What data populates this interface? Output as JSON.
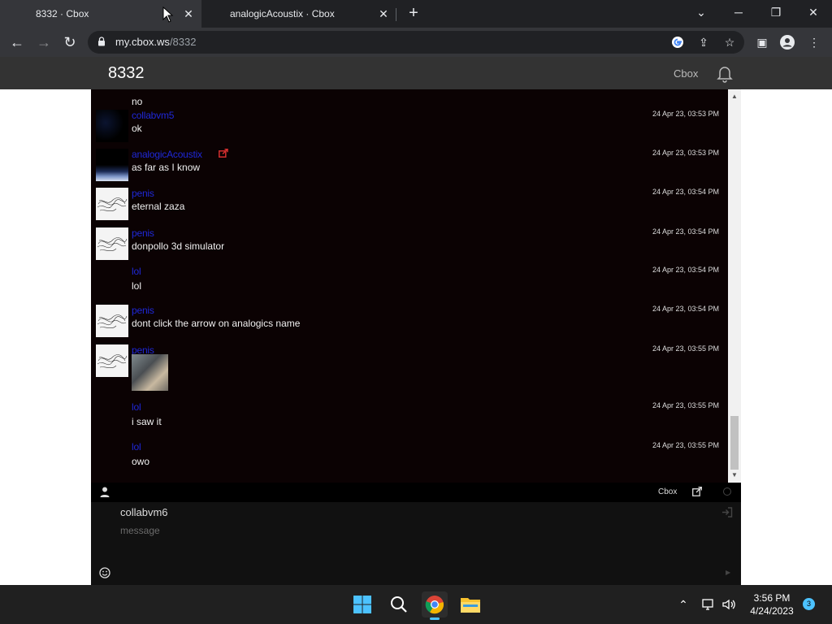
{
  "browser": {
    "tabs": [
      {
        "title": "8332 · Cbox",
        "active": true
      },
      {
        "title": "analogicAcoustix · Cbox",
        "active": false
      }
    ],
    "address": {
      "host": "my.cbox.ws",
      "path": "/8332"
    }
  },
  "site": {
    "title": "8332",
    "brand_link": "Cbox"
  },
  "messages": [
    {
      "user": "",
      "text": "no",
      "time": "",
      "avatar": "none"
    },
    {
      "user": "collabvm5",
      "text": "ok",
      "time": "24 Apr 23, 03:53 PM",
      "avatar": "dark"
    },
    {
      "user": "analogicAcoustix",
      "text": "as far as I know",
      "time": "24 Apr 23, 03:53 PM",
      "avatar": "space",
      "has_link_icon": true
    },
    {
      "user": "penis",
      "text": "eternal zaza",
      "time": "24 Apr 23, 03:54 PM",
      "avatar": "scribble"
    },
    {
      "user": "penis",
      "text": "donpollo 3d simulator",
      "time": "24 Apr 23, 03:54 PM",
      "avatar": "scribble"
    },
    {
      "user": "lol",
      "text": "lol",
      "time": "24 Apr 23, 03:54 PM",
      "avatar": "none"
    },
    {
      "user": "penis",
      "text": "dont click the arrow on analogics name",
      "time": "24 Apr 23, 03:54 PM",
      "avatar": "scribble"
    },
    {
      "user": "penis",
      "text": "",
      "time": "24 Apr 23, 03:55 PM",
      "avatar": "scribble",
      "image": true
    },
    {
      "user": "lol",
      "text": "i saw it",
      "time": "24 Apr 23, 03:55 PM",
      "avatar": "none"
    },
    {
      "user": "lol",
      "text": "owo",
      "time": "24 Apr 23, 03:55 PM",
      "avatar": "none"
    }
  ],
  "statusbar": {
    "brand": "Cbox"
  },
  "composer": {
    "name": "collabvm6",
    "placeholder": "message"
  },
  "taskbar": {
    "time": "3:56 PM",
    "date": "4/24/2023",
    "notifications": "3"
  },
  "colors": {
    "username": "#1f28d8",
    "chat_bg": "#0b0203",
    "header_bg": "#333333",
    "accent": "#4cc2ff"
  }
}
